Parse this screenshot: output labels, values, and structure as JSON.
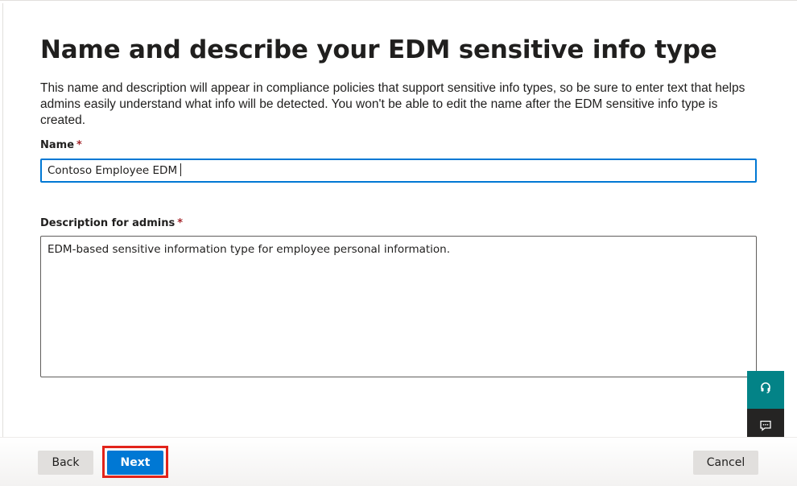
{
  "page": {
    "title": "Name and describe your EDM sensitive info type",
    "description": "This name and description will appear in compliance policies that support sensitive info types, so be sure to enter text that helps admins easily understand what info will be detected. You won't be able to edit the name after the EDM sensitive info type is created."
  },
  "form": {
    "name": {
      "label": "Name",
      "required_mark": "*",
      "value": "Contoso Employee EDM"
    },
    "description": {
      "label": "Description for admins",
      "required_mark": "*",
      "value": "EDM-based sensitive information type for employee personal information."
    }
  },
  "footer": {
    "back_label": "Back",
    "next_label": "Next",
    "cancel_label": "Cancel"
  },
  "side_buttons": {
    "help_icon": "headset-icon",
    "feedback_icon": "feedback-chat-icon"
  },
  "colors": {
    "accent": "#0078d4",
    "highlight": "#e2231a",
    "help_bg": "#038387",
    "feedback_bg": "#252423",
    "required": "#a4262c"
  }
}
